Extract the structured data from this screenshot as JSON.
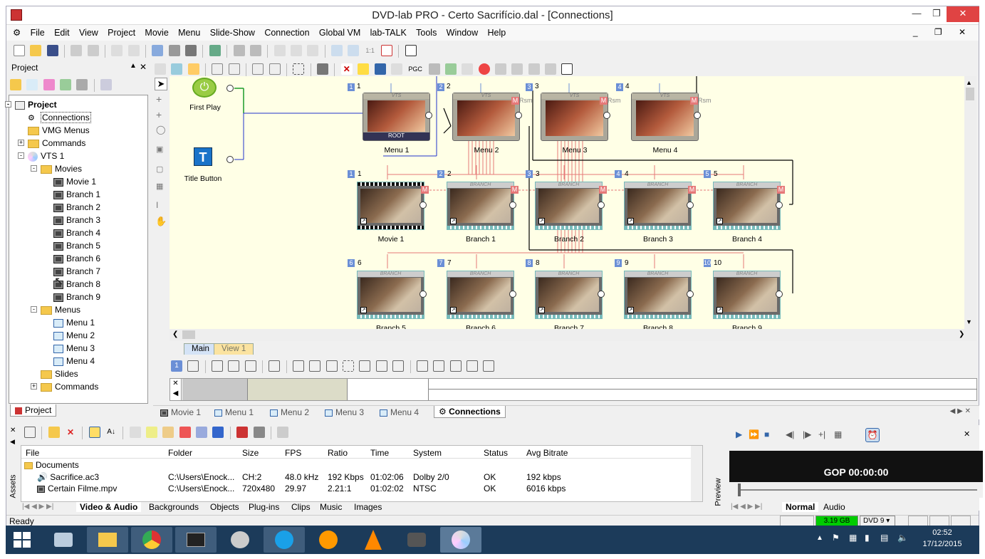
{
  "window": {
    "title": "DVD-lab PRO - Certo Sacrifício.dal - [Connections]"
  },
  "menu": [
    "File",
    "Edit",
    "View",
    "Project",
    "Movie",
    "Menu",
    "Slide-Show",
    "Connection",
    "Global VM",
    "lab-TALK",
    "Tools",
    "Window",
    "Help"
  ],
  "project_panel": {
    "title": "Project",
    "tree": [
      {
        "label": "Project",
        "level": 0,
        "type": "project"
      },
      {
        "label": "Connections",
        "level": 1,
        "type": "connections"
      },
      {
        "label": "VMG Menus",
        "level": 1,
        "type": "folder"
      },
      {
        "label": "Commands",
        "level": 1,
        "type": "folder"
      },
      {
        "label": "VTS 1",
        "level": 1,
        "type": "vts"
      },
      {
        "label": "Movies",
        "level": 2,
        "type": "folder"
      },
      {
        "label": "Movie 1",
        "level": 3,
        "type": "film"
      },
      {
        "label": "Branch 1",
        "level": 3,
        "type": "film"
      },
      {
        "label": "Branch 2",
        "level": 3,
        "type": "film"
      },
      {
        "label": "Branch 3",
        "level": 3,
        "type": "film"
      },
      {
        "label": "Branch 4",
        "level": 3,
        "type": "film"
      },
      {
        "label": "Branch 5",
        "level": 3,
        "type": "film"
      },
      {
        "label": "Branch 6",
        "level": 3,
        "type": "film"
      },
      {
        "label": "Branch 7",
        "level": 3,
        "type": "film"
      },
      {
        "label": "Branch 8",
        "level": 3,
        "type": "film"
      },
      {
        "label": "Branch 9",
        "level": 3,
        "type": "film"
      },
      {
        "label": "Menus",
        "level": 2,
        "type": "folder"
      },
      {
        "label": "Menu 1",
        "level": 3,
        "type": "menu"
      },
      {
        "label": "Menu 2",
        "level": 3,
        "type": "menu"
      },
      {
        "label": "Menu 3",
        "level": 3,
        "type": "menu"
      },
      {
        "label": "Menu 4",
        "level": 3,
        "type": "menu"
      },
      {
        "label": "Slides",
        "level": 2,
        "type": "folder"
      },
      {
        "label": "Commands",
        "level": 2,
        "type": "folder"
      }
    ],
    "bottom_tab": "Project"
  },
  "canvas": {
    "first_play": "First Play",
    "title_button": "Title Button",
    "menus": [
      {
        "num": "1",
        "label": "Menu 1",
        "top": "VTS",
        "root": "ROOT"
      },
      {
        "num": "2",
        "label": "Menu 2",
        "top": "VTS",
        "rsm": "Rsm"
      },
      {
        "num": "3",
        "label": "Menu 3",
        "top": "VTS",
        "rsm": "Rsm"
      },
      {
        "num": "4",
        "label": "Menu 4",
        "top": "VTS",
        "rsm": "Rsm"
      }
    ],
    "movies_row1": [
      {
        "num": "1",
        "label": "Movie 1",
        "top": ""
      },
      {
        "num": "2",
        "label": "Branch 1",
        "top": "BRANCH"
      },
      {
        "num": "3",
        "label": "Branch 2",
        "top": "BRANCH"
      },
      {
        "num": "4",
        "label": "Branch 3",
        "top": "BRANCH"
      },
      {
        "num": "5",
        "label": "Branch 4",
        "top": "BRANCH"
      }
    ],
    "movies_row2": [
      {
        "num": "6",
        "label": "Branch 5",
        "top": "BRANCH"
      },
      {
        "num": "7",
        "label": "Branch 6",
        "top": "BRANCH"
      },
      {
        "num": "8",
        "label": "Branch 7",
        "top": "BRANCH"
      },
      {
        "num": "9",
        "label": "Branch 8",
        "top": "BRANCH"
      },
      {
        "num": "10",
        "label": "Branch 9",
        "top": "BRANCH"
      }
    ],
    "m_badge": "M",
    "pgc_label": "PGC",
    "zoom_label": "1:1"
  },
  "view_tabs": [
    "Main",
    "View 1"
  ],
  "doc_tabs": [
    "Movie 1",
    "Menu 1",
    "Menu 2",
    "Menu 3",
    "Menu 4",
    "Connections"
  ],
  "assets": {
    "side_label": "Assets",
    "columns": [
      "File",
      "Folder",
      "Size",
      "FPS",
      "Ratio",
      "Time",
      "System",
      "Status",
      "Avg Bitrate"
    ],
    "group": "Documents",
    "rows": [
      {
        "file": "Sacrifice.ac3",
        "folder": "C:\\Users\\Enock...",
        "size": "CH:2",
        "fps": "48.0 kHz",
        "ratio": "192 Kbps",
        "time": "01:02:06",
        "system": "Dolby 2/0",
        "status": "OK",
        "bitrate": "192 kbps"
      },
      {
        "file": "Certain Filme.mpv",
        "folder": "C:\\Users\\Enock...",
        "size": "720x480",
        "fps": "29.97",
        "ratio": "2.21:1",
        "time": "01:02:02",
        "system": "NTSC",
        "status": "OK",
        "bitrate": "6016 kbps"
      }
    ],
    "tabs": [
      "Video & Audio",
      "Backgrounds",
      "Objects",
      "Plug-ins",
      "Clips",
      "Music",
      "Images"
    ]
  },
  "preview": {
    "side_label": "Preview",
    "gop": "GOP 00:00:00",
    "tabs": [
      "Normal",
      "Audio"
    ]
  },
  "status": {
    "text": "Ready",
    "size": "3.19 GB",
    "disc": "DVD 9"
  },
  "clock": {
    "time": "02:52",
    "date": "17/12/2015"
  },
  "colors": {
    "canvas": "#ffffe6",
    "accent": "#6b8fd6",
    "badge": "#e67878",
    "taskbar": "#1c3b5a"
  }
}
